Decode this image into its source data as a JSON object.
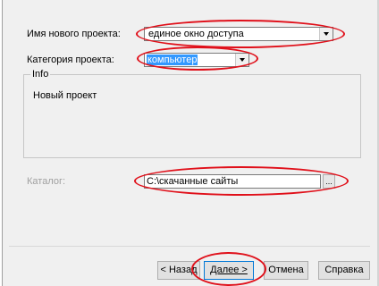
{
  "form": {
    "project_name_label": "Имя нового проекта:",
    "project_name_value": "единое окно доступа",
    "category_label": "Категория проекта:",
    "category_value": "компьютер",
    "info_legend": "Info",
    "info_text": "Новый проект",
    "catalog_label": "Каталог:",
    "catalog_value": "C:\\скачанные сайты",
    "browse_label": "..."
  },
  "buttons": {
    "back": "< Назад",
    "next": "Далее >",
    "cancel": "Отмена",
    "help": "Справка"
  },
  "colors": {
    "highlight": "#e0101a",
    "selection": "#3399ff"
  }
}
